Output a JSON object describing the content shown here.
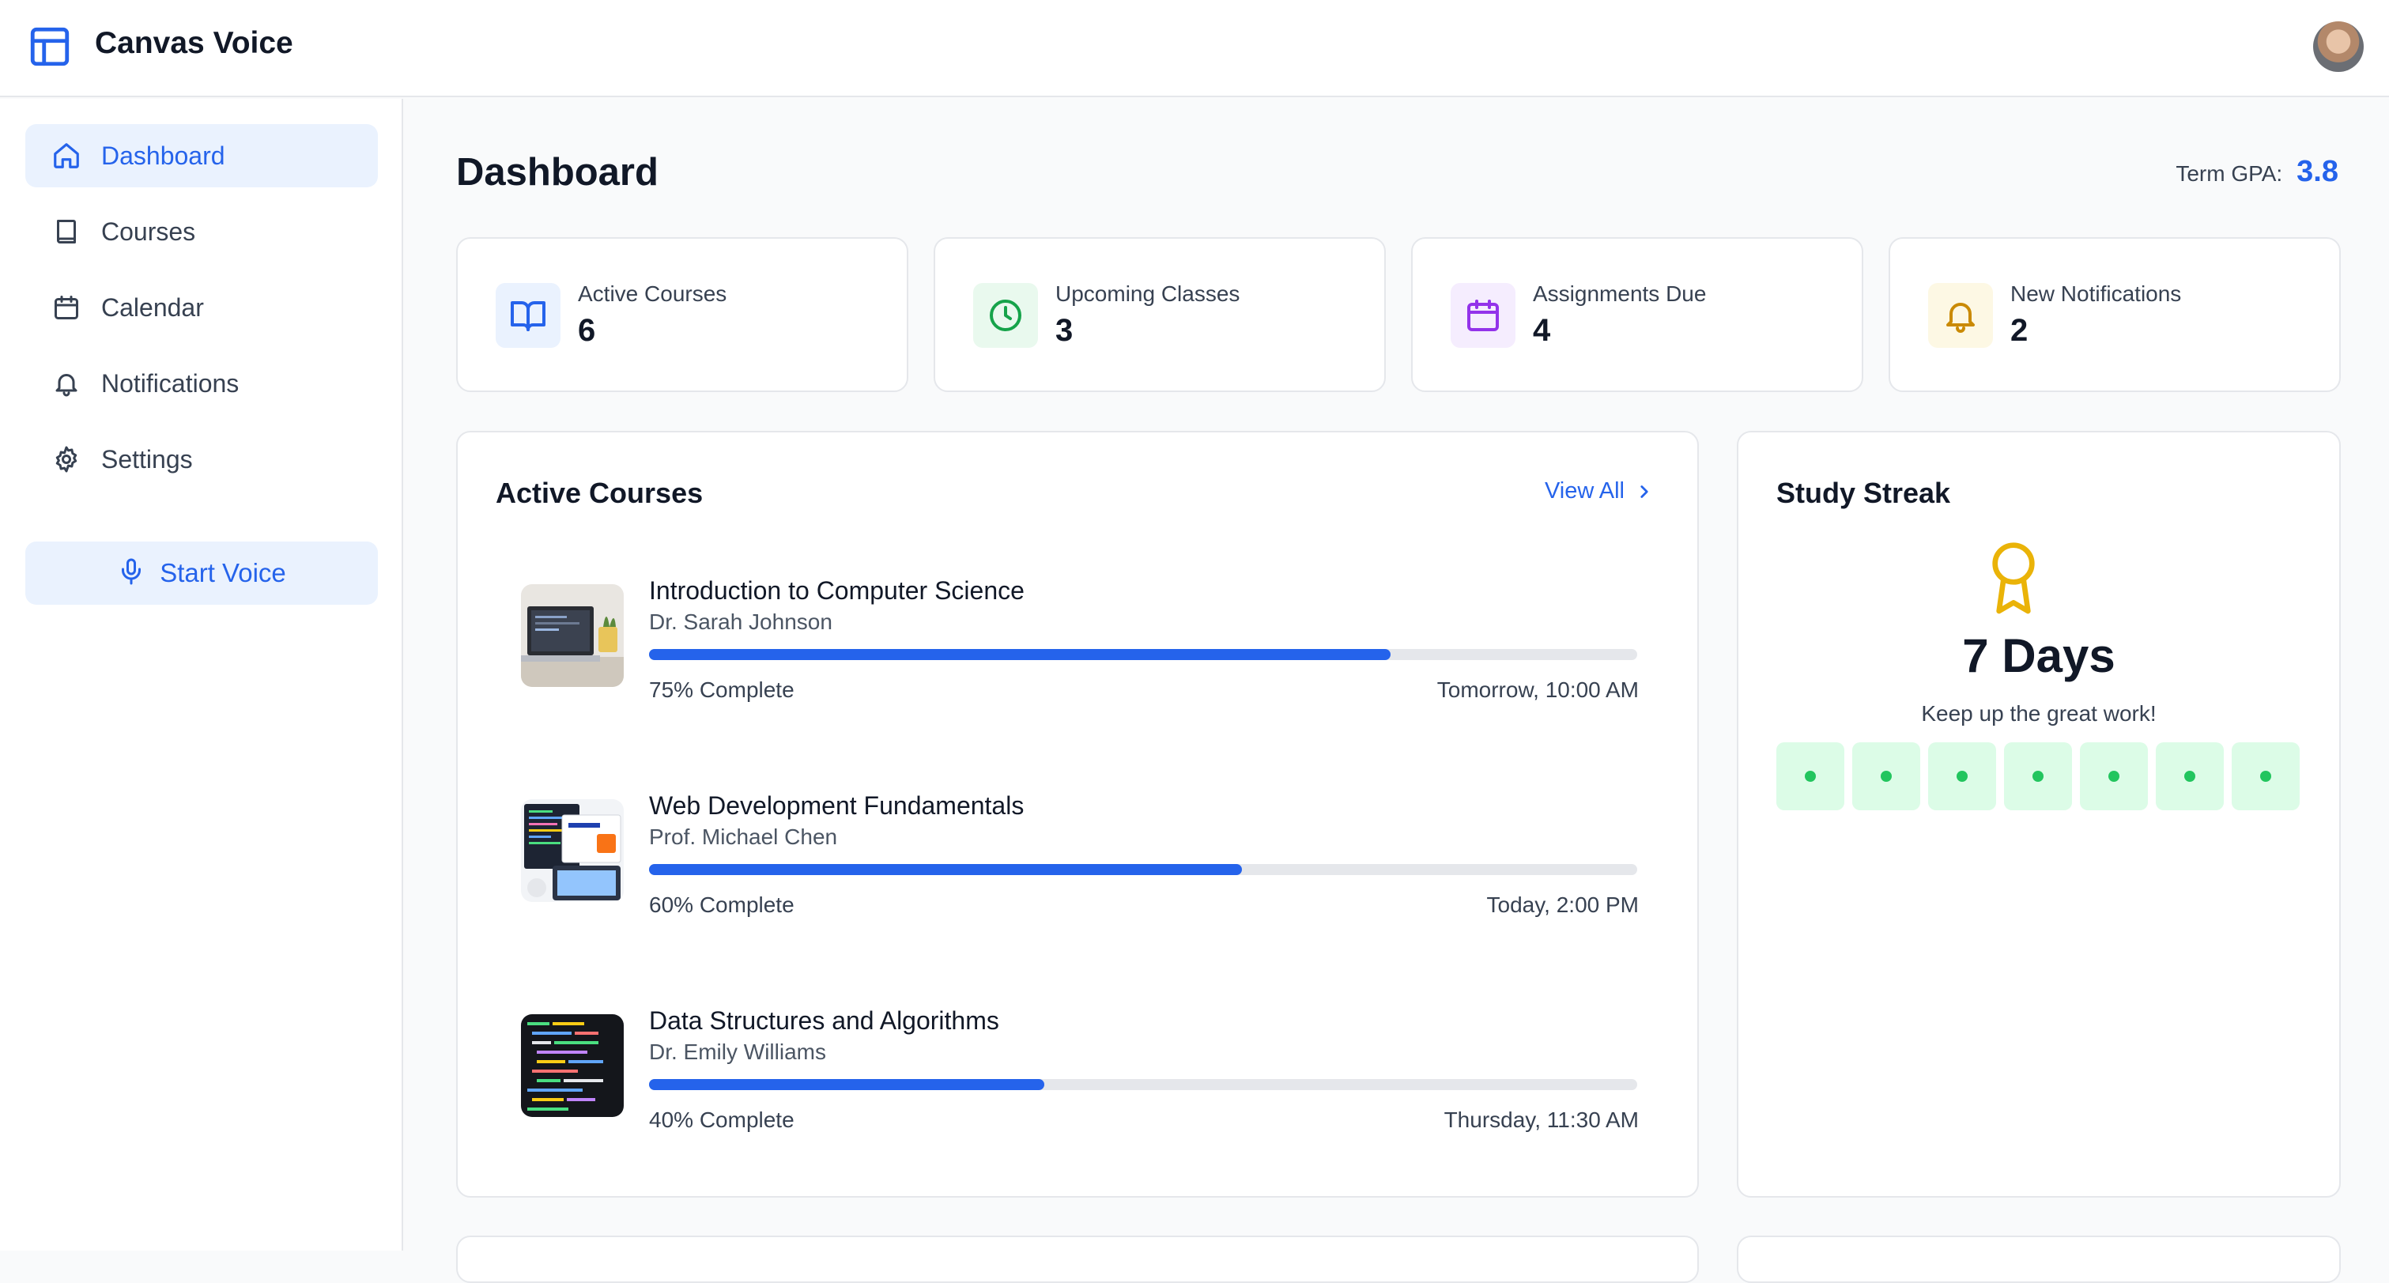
{
  "app": {
    "name": "Canvas Voice"
  },
  "sidebar": {
    "items": [
      {
        "label": "Dashboard",
        "icon": "home-icon",
        "active": true
      },
      {
        "label": "Courses",
        "icon": "book-icon",
        "active": false
      },
      {
        "label": "Calendar",
        "icon": "calendar-icon",
        "active": false
      },
      {
        "label": "Notifications",
        "icon": "bell-icon",
        "active": false
      },
      {
        "label": "Settings",
        "icon": "gear-icon",
        "active": false
      }
    ],
    "voice_button": {
      "label": "Start Voice",
      "icon": "microphone-icon"
    }
  },
  "header": {
    "title": "Dashboard",
    "gpa_label": "Term GPA:",
    "gpa_value": "3.8"
  },
  "stats": [
    {
      "label": "Active Courses",
      "value": "6",
      "icon": "open-book-icon",
      "color": "#2563eb"
    },
    {
      "label": "Upcoming Classes",
      "value": "3",
      "icon": "clock-icon",
      "color": "#16a34a"
    },
    {
      "label": "Assignments Due",
      "value": "4",
      "icon": "calendar-icon",
      "color": "#9333ea"
    },
    {
      "label": "New Notifications",
      "value": "2",
      "icon": "bell-icon",
      "color": "#ca8a04"
    }
  ],
  "active_courses": {
    "title": "Active Courses",
    "view_all_label": "View All",
    "courses": [
      {
        "title": "Introduction to Computer Science",
        "instructor": "Dr. Sarah Johnson",
        "progress": 0.75,
        "progress_label": "75% Complete",
        "next_class": "Tomorrow, 10:00 AM"
      },
      {
        "title": "Web Development Fundamentals",
        "instructor": "Prof. Michael Chen",
        "progress": 0.6,
        "progress_label": "60% Complete",
        "next_class": "Today, 2:00 PM"
      },
      {
        "title": "Data Structures and Algorithms",
        "instructor": "Dr. Emily Williams",
        "progress": 0.4,
        "progress_label": "40% Complete",
        "next_class": "Thursday, 11:30 AM"
      }
    ]
  },
  "study_streak": {
    "title": "Study Streak",
    "days_label": "7 Days",
    "message": "Keep up the great work!",
    "completed_days": 7,
    "icon": "award-icon"
  },
  "colors": {
    "accent": "#2563eb",
    "accent_soft": "#eaf2fe",
    "streak_fill": "#dcfce7",
    "streak_dot": "#22c55e"
  }
}
